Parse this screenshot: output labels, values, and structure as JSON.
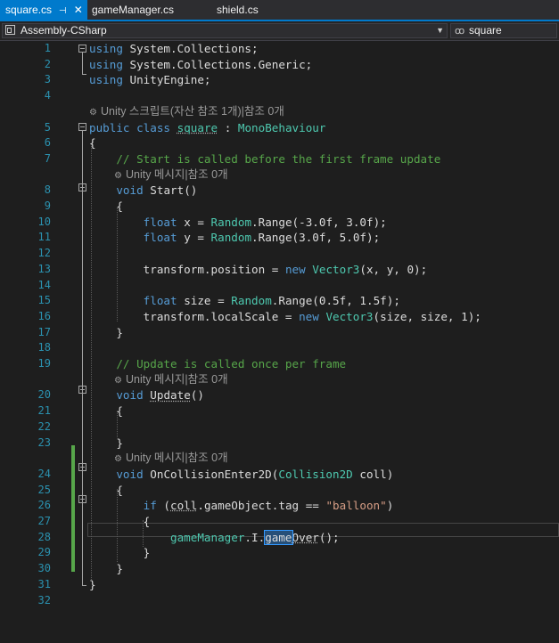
{
  "tabs": [
    {
      "label": "square.cs",
      "active": true
    },
    {
      "label": "gameManager.cs",
      "active": false
    },
    {
      "label": "shield.cs",
      "active": false
    }
  ],
  "nav": {
    "project": "Assembly-CSharp",
    "member": "square"
  },
  "codelens": {
    "class_refs": "Unity 스크립트(자산 참조 1개)|참조 0개",
    "message_refs": "Unity 메시지|참조 0개"
  },
  "line_numbers": [
    "1",
    "2",
    "3",
    "4",
    "5",
    "6",
    "7",
    "8",
    "9",
    "10",
    "11",
    "12",
    "13",
    "14",
    "15",
    "16",
    "17",
    "18",
    "19",
    "20",
    "21",
    "22",
    "23",
    "24",
    "25",
    "26",
    "27",
    "28",
    "29",
    "30",
    "31",
    "32"
  ],
  "code": {
    "using": "using",
    "ns1": "System.Collections",
    "ns2": "System.Collections.Generic",
    "ns3": "UnityEngine",
    "public": "public",
    "class": "class",
    "class_name": "square",
    "colon": ":",
    "base": "MonoBehaviour",
    "comment_start": "// Start is called before the first frame update",
    "void": "void",
    "start": "Start",
    "float": "float",
    "var_x": "x",
    "var_y": "y",
    "random": "Random",
    "range": "Range",
    "arg_x1": "-3.0f",
    "arg_x2": "3.0f",
    "arg_y1": "3.0f",
    "arg_y2": "5.0f",
    "transform": "transform",
    "position": "position",
    "new": "new",
    "vector3": "Vector3",
    "pos_args": "x, y, 0",
    "size": "size",
    "arg_s1": "0.5f",
    "arg_s2": "1.5f",
    "localscale": "localScale",
    "scale_args": "size, size, 1",
    "comment_update": "// Update is called once per frame",
    "update": "Update",
    "oncollision": "OnCollisionEnter2D",
    "collision2d": "Collision2D",
    "coll": "coll",
    "if": "if",
    "gameobject_tag": "gameObject.tag",
    "eq": "==",
    "balloon": "\"balloon\"",
    "gamemanager": "gameManager",
    "inst": "I",
    "game": "game",
    "over": "Over",
    "call_end": "();"
  },
  "colors": {
    "keyword": "#569cd6",
    "type": "#4ec9b0",
    "comment": "#57a64a",
    "string": "#d69d85",
    "line_number": "#2b91af",
    "accent": "#007acc"
  }
}
